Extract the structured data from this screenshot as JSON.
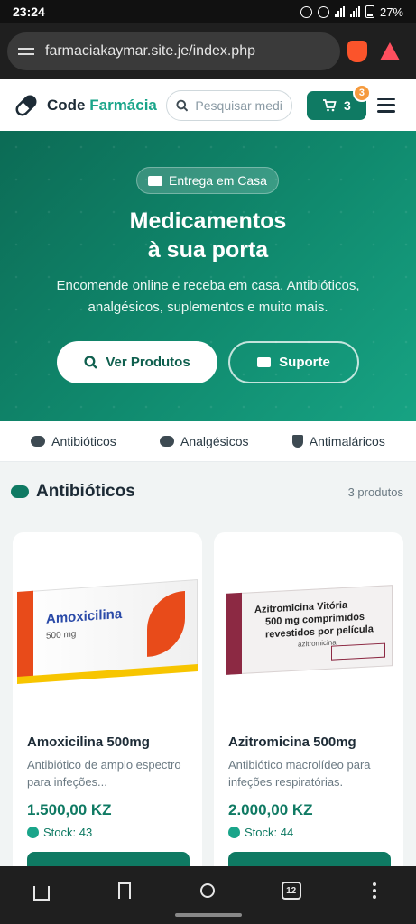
{
  "status_bar": {
    "time": "23:24",
    "battery": "27%"
  },
  "browser": {
    "url": "farmaciakaymar.site.je/index.php",
    "tab_count": "12"
  },
  "header": {
    "brand_part1": "Code",
    "brand_part2": "Farmácia",
    "search_placeholder": "Pesquisar medi",
    "cart_count": "3",
    "cart_badge": "3"
  },
  "hero": {
    "chip": "Entrega em Casa",
    "title_line1": "Medicamentos",
    "title_line2": "à sua porta",
    "subtitle": "Encomende online e receba em casa. Antibióticos, analgésicos, suplementos e muito mais.",
    "primary_button": "Ver Produtos",
    "secondary_button": "Suporte"
  },
  "categories": [
    {
      "label": "Antibióticos"
    },
    {
      "label": "Analgésicos"
    },
    {
      "label": "Antimaláricos"
    }
  ],
  "section": {
    "title": "Antibióticos",
    "count": "3 produtos"
  },
  "products": [
    {
      "name": "Amoxicilina 500mg",
      "description": "Antibiótico de amplo espectro para infeções...",
      "price": "1.500,00 KZ",
      "stock": "Stock: 43",
      "box_title": "Amoxicilina",
      "box_sub": "500 mg"
    },
    {
      "name": "Azitromicina 500mg",
      "description": "Antibiótico macrolídeo para infeções respiratórias.",
      "price": "2.000,00 KZ",
      "stock": "Stock: 44",
      "box_line1": "Azitromicina Vitória",
      "box_line2": "500 mg comprimidos",
      "box_line3": "revestidos por película",
      "box_line4": "azitromicina"
    }
  ],
  "colors": {
    "primary": "#0f7a63",
    "accent": "#1aa58a",
    "badge": "#f59a3d"
  }
}
